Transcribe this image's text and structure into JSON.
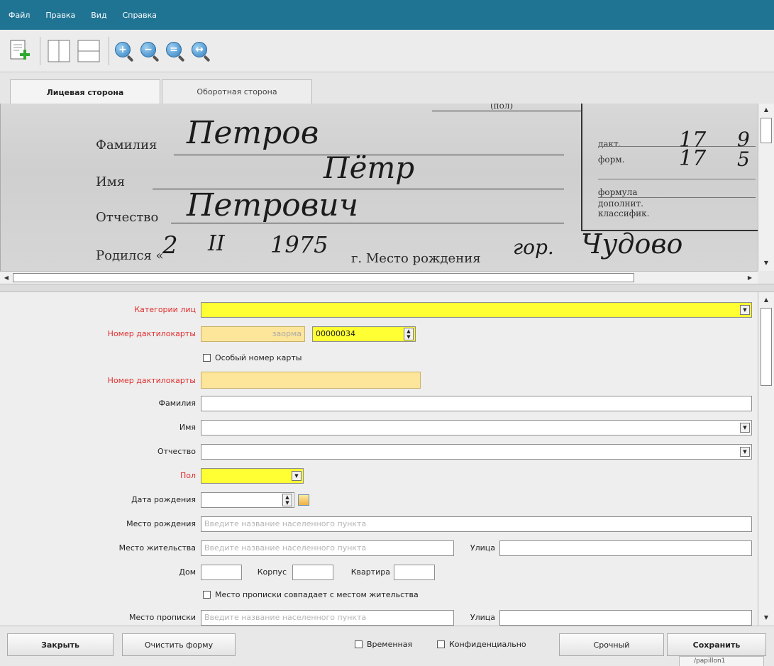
{
  "menu": [
    "Файл",
    "Правка",
    "Вид",
    "Справка"
  ],
  "toolbar": {
    "zoom_icons": [
      "+",
      "−",
      "=",
      "↔"
    ]
  },
  "tabs": {
    "front": "Лицевая сторона",
    "back": "Оборотная сторона"
  },
  "scan": {
    "top_fragment": "(пол)",
    "labels": {
      "surname": "Фамилия",
      "name": "Имя",
      "patronymic": "Отчество",
      "born": "Родился «",
      "born_g": "г. Место рождения"
    },
    "handwriting": {
      "surname": "Петров",
      "name": "Пётр",
      "patronymic": "Петрович",
      "day": "2",
      "month": "II",
      "year": "1975",
      "place_prefix": "гор.",
      "place": "Чудово"
    },
    "side_labels": {
      "dakt": "дакт.",
      "forma": "форм.",
      "formula": "формула",
      "dop1": "дополнит.",
      "dop2": "классифик."
    },
    "side_values": {
      "v1": "17",
      "v2": "17",
      "v3": "9",
      "v4": "5"
    }
  },
  "form": {
    "category": {
      "label": "Категории лиц",
      "value": ""
    },
    "card_number": {
      "label": "Номер дактилокарты",
      "hint": "заорма",
      "value": "00000034"
    },
    "special_number": {
      "label": "Особый номер карты"
    },
    "card_number2": {
      "label": "Номер дактилокарты",
      "value": ""
    },
    "surname": {
      "label": "Фамилия",
      "value": ""
    },
    "name": {
      "label": "Имя",
      "value": ""
    },
    "patronymic": {
      "label": "Отчество",
      "value": ""
    },
    "sex": {
      "label": "Пол",
      "value": ""
    },
    "birth_date": {
      "label": "Дата рождения",
      "value": ""
    },
    "birth_place": {
      "label": "Место рождения",
      "placeholder": "Введите название населенного пункта"
    },
    "residence": {
      "label": "Место жительства",
      "placeholder": "Введите название населенного пункта",
      "street_label": "Улица"
    },
    "house": {
      "label": "Дом",
      "korpus_label": "Корпус",
      "apt_label": "Квартира"
    },
    "same_address": {
      "label": "Место прописки совпадает с местом жительства"
    },
    "registration": {
      "label": "Место прописки",
      "placeholder": "Введите название населенного пункта",
      "street_label": "Улица"
    }
  },
  "buttons": {
    "close": "Закрыть",
    "clear": "Очистить форму",
    "temporary": "Временная",
    "confidential": "Конфиденциально",
    "urgent": "Срочный",
    "save": "Сохранить"
  },
  "status": "/papillon1"
}
